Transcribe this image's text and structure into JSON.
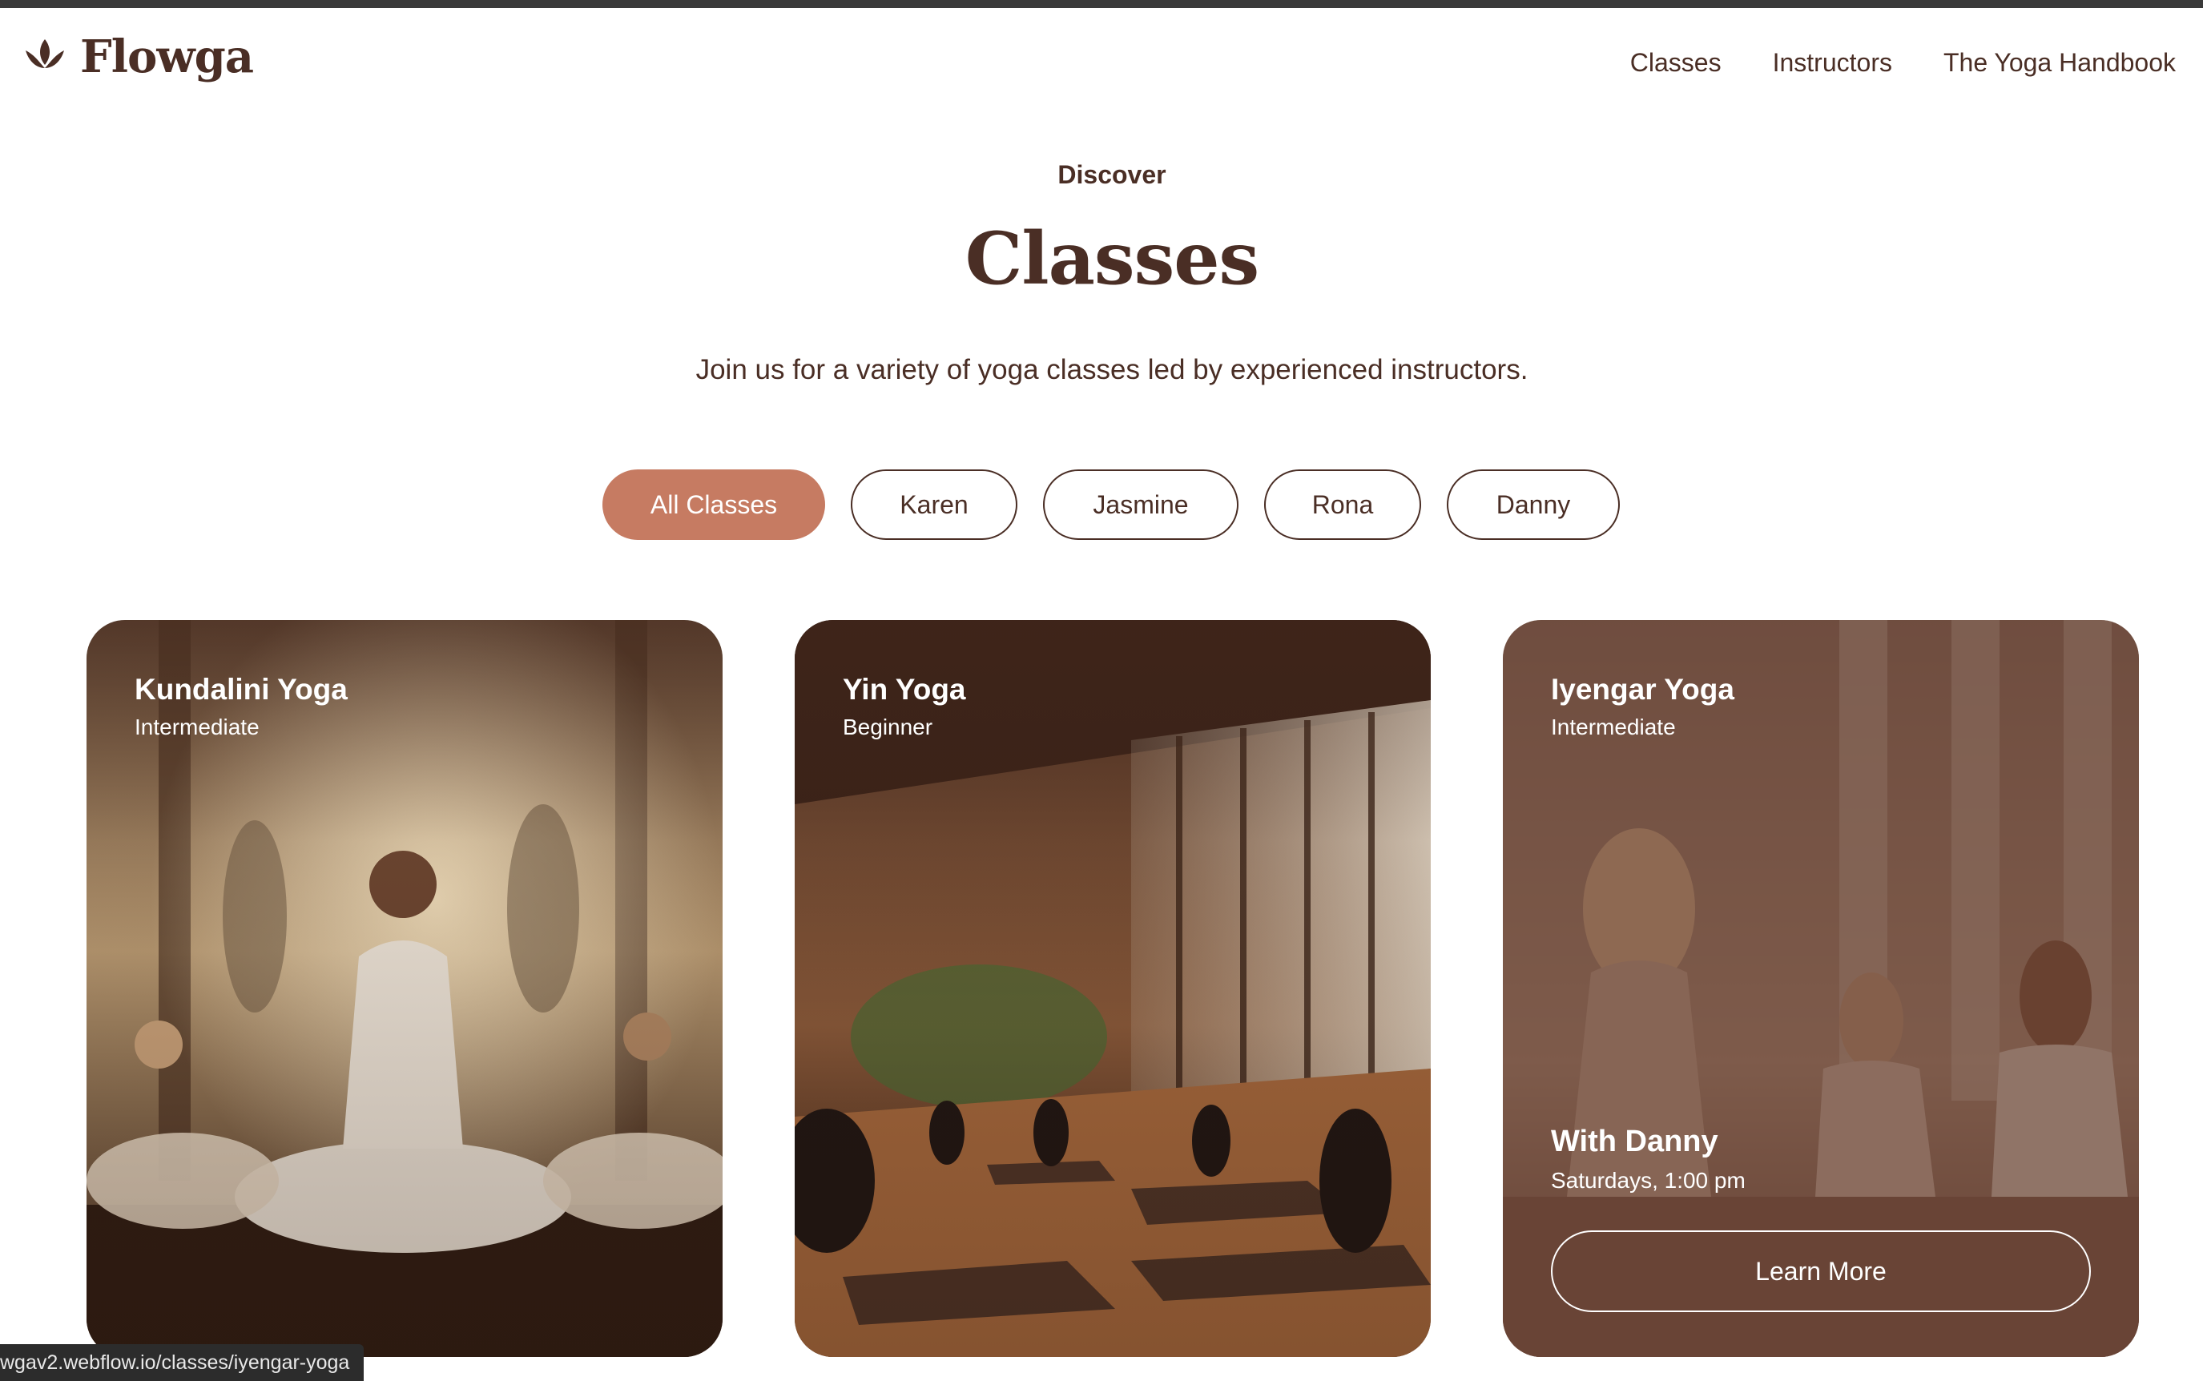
{
  "brand": {
    "name": "Flowga",
    "logo_icon": "lotus-icon"
  },
  "nav": {
    "items": [
      "Classes",
      "Instructors",
      "The Yoga Handbook"
    ]
  },
  "hero": {
    "eyebrow": "Discover",
    "title": "Classes",
    "subtitle": "Join us for a variety of yoga classes led by experienced instructors."
  },
  "filters": {
    "items": [
      "All Classes",
      "Karen",
      "Jasmine",
      "Rona",
      "Danny"
    ],
    "active": "All Classes"
  },
  "cards": [
    {
      "name": "Kundalini Yoga",
      "level": "Intermediate"
    },
    {
      "name": "Yin Yoga",
      "level": "Beginner"
    },
    {
      "name": "Iyengar Yoga",
      "level": "Intermediate",
      "instructor": "With Danny",
      "schedule": "Saturdays, 1:00 pm",
      "button": "Learn More"
    }
  ],
  "status_bar": {
    "url": "wgav2.webflow.io/classes/iyengar-yoga"
  },
  "colors": {
    "brand_brown": "#4a2e25",
    "accent": "#c67b62"
  }
}
